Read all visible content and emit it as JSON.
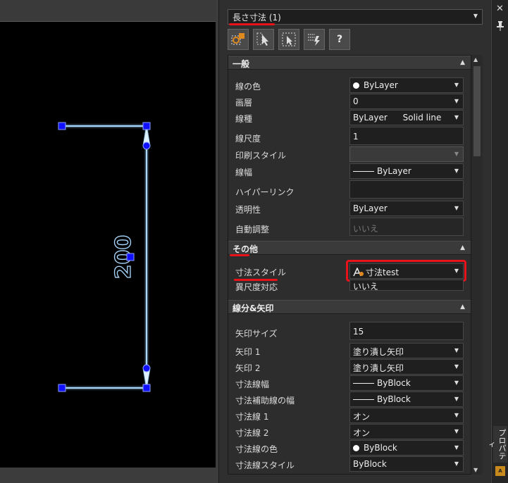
{
  "canvas": {
    "dimension_text": "200"
  },
  "panel": {
    "selector": "長さ寸法 (1)",
    "toolbar": [
      "quick-select-icon",
      "select-objects-icon",
      "toggle-pickadd-icon",
      "filter-icon",
      "help-icon"
    ],
    "help_label": "?",
    "sections": {
      "general": {
        "title": "一般",
        "rows": [
          {
            "label": "線の色",
            "value": "ByLayer"
          },
          {
            "label": "画層",
            "value": "0"
          },
          {
            "label": "線種",
            "value": "ByLayer",
            "value2": "Solid line"
          },
          {
            "label": "線尺度",
            "value": "1"
          },
          {
            "label": "印刷スタイル",
            "value": ""
          },
          {
            "label": "線幅",
            "value": "ByLayer"
          },
          {
            "label": "ハイパーリンク",
            "value": ""
          },
          {
            "label": "透明性",
            "value": "ByLayer"
          },
          {
            "label": "自動調整",
            "value": "いいえ"
          }
        ]
      },
      "other": {
        "title": "その他",
        "rows": [
          {
            "label": "寸法スタイル",
            "value": "寸法test"
          },
          {
            "label": "異尺度対応",
            "value": "いいえ"
          }
        ]
      },
      "lines": {
        "title": "線分&矢印",
        "rows": [
          {
            "label": "矢印サイズ",
            "value": "15"
          },
          {
            "label": "矢印 1",
            "value": "塗り潰し矢印"
          },
          {
            "label": "矢印 2",
            "value": "塗り潰し矢印"
          },
          {
            "label": "寸法線幅",
            "value": "ByBlock"
          },
          {
            "label": "寸法補助線の幅",
            "value": "ByBlock"
          },
          {
            "label": "寸法線 1",
            "value": "オン"
          },
          {
            "label": "寸法線 2",
            "value": "オン"
          },
          {
            "label": "寸法線の色",
            "value": "ByBlock"
          },
          {
            "label": "寸法線スタイル",
            "value": "ByBlock"
          }
        ]
      }
    }
  },
  "dock": {
    "tab_label": "プロパティ",
    "close": "✕",
    "pin": "📌",
    "icon_text": "A"
  },
  "colors": {
    "highlight": "#e8121a",
    "selection_grip": "#1010ff",
    "dimension_line": "#a8d8ff"
  }
}
